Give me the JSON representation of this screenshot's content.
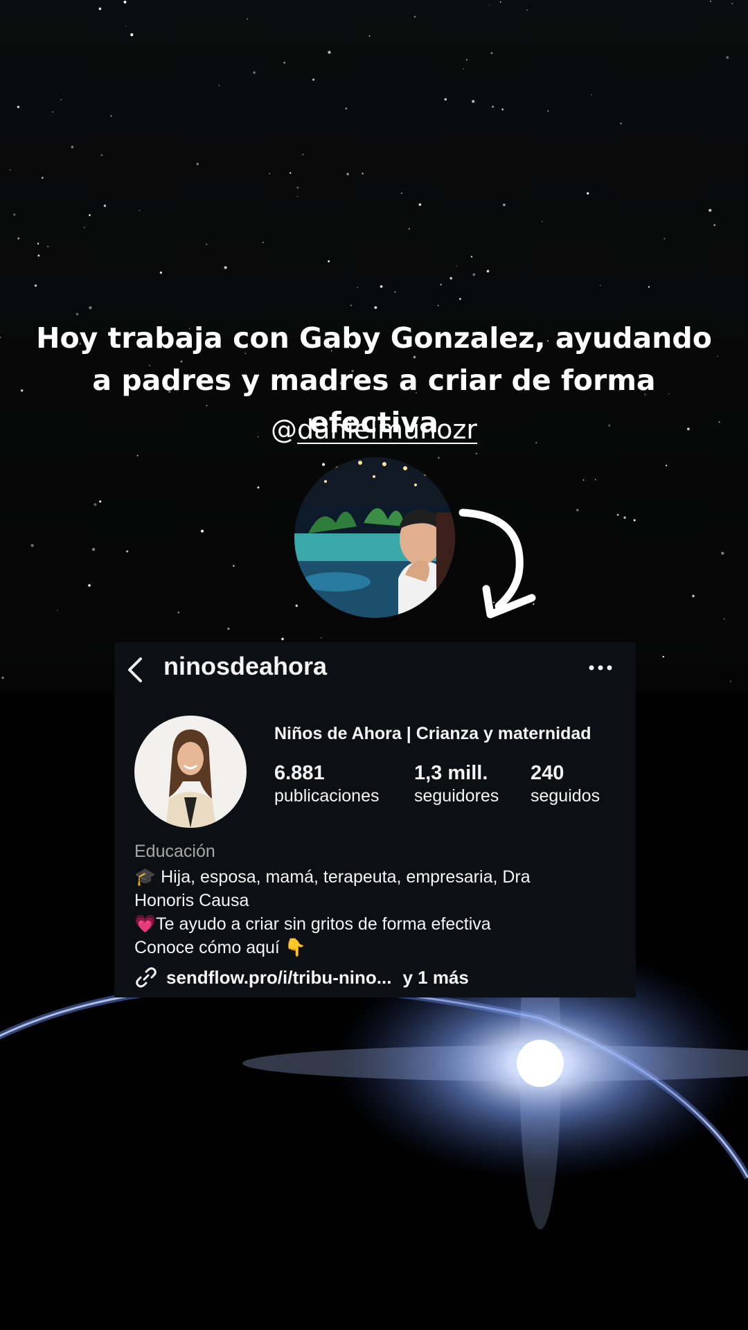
{
  "story": {
    "headline_line1": "Hoy trabaja con Gaby Gonzalez, ayudando",
    "headline_line2": "a padres y madres a criar de forma efectiva",
    "handle_at": "@",
    "handle_name": "danielmunozr"
  },
  "profile": {
    "username": "ninosdeahora",
    "full_name": "Niños de Ahora | Crianza y maternidad",
    "stats": [
      {
        "value": "6.881",
        "label": "publicaciones"
      },
      {
        "value": "1,3 mill.",
        "label": "seguidores"
      },
      {
        "value": "240",
        "label": "seguidos"
      }
    ],
    "category": "Educación",
    "bio": [
      "🎓 Hija, esposa, mamá, terapeuta, empresaria, Dra",
      "Honoris Causa",
      "💗Te ayudo a criar sin gritos de forma efectiva",
      "Conoce cómo aquí 👇"
    ],
    "link": "sendflow.pro/i/tribu-nino...",
    "link_more": "y 1 más"
  },
  "icons": [
    "back-chevron-icon",
    "more-options-icon",
    "link-icon",
    "curved-arrow-icon"
  ],
  "colors": {
    "card_bg": "#0c1014",
    "text": "#f5f5f5",
    "muted": "#a8a8a8",
    "glow": "#6f8fe0"
  }
}
